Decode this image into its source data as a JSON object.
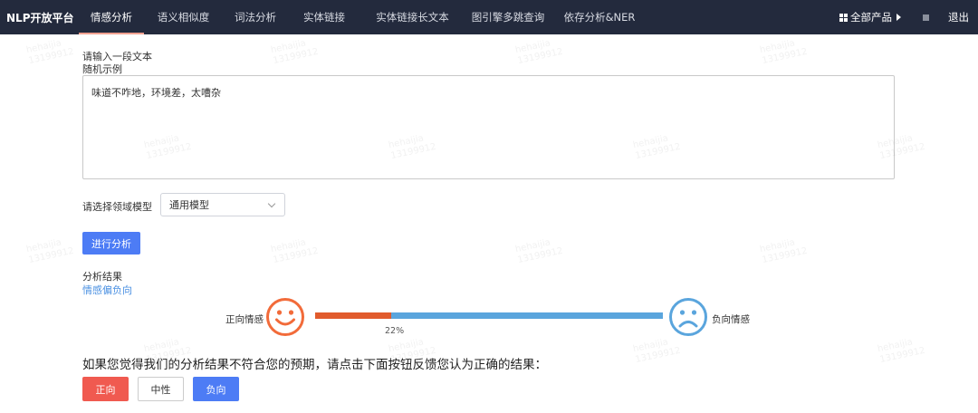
{
  "nav": {
    "brand": "NLP开放平台",
    "items": [
      {
        "label": "情感分析",
        "active": true
      },
      {
        "label": "语义相似度",
        "active": false
      },
      {
        "label": "词法分析",
        "active": false
      },
      {
        "label": "实体链接",
        "active": false
      },
      {
        "label": "实体链接长文本",
        "active": false
      },
      {
        "label": "图引擎多跳查询",
        "active": false
      },
      {
        "label": "依存分析&NER",
        "active": false
      }
    ],
    "all_products": "全部产品",
    "logout": "退出"
  },
  "form": {
    "input_label": "请输入一段文本",
    "random_example": "随机示例",
    "text_value": "味道不咋地，环境差，太嘈杂",
    "model_label": "请选择领域模型",
    "model_selected": "通用模型",
    "analyze_button": "进行分析"
  },
  "result": {
    "label": "分析结果",
    "value": "情感偏负向",
    "positive_label": "正向情感",
    "negative_label": "负向情感",
    "positive_percent": 22,
    "percent_text": "22%"
  },
  "feedback": {
    "prompt": "如果您觉得我们的分析结果不符合您的预期，请点击下面按钮反馈您认为正确的结果：",
    "positive": "正向",
    "neutral": "中性",
    "negative": "负向"
  },
  "colors": {
    "nav_bg": "#232a3d",
    "primary": "#4d7cf5",
    "positive_bar": "#e15b2c",
    "negative_bar": "#5aa5dd",
    "positive_face": "#f26b3a",
    "negative_face": "#5aa5dd"
  },
  "watermark": {
    "line1": "hehaijia",
    "line2": "13199912"
  }
}
